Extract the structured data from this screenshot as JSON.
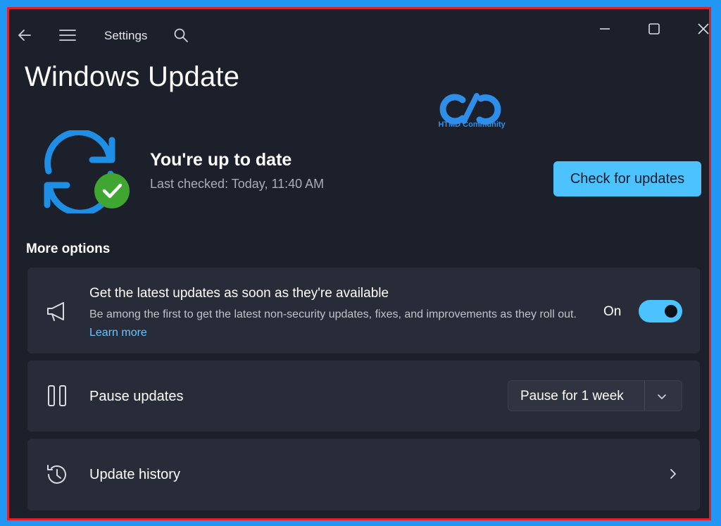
{
  "window": {
    "app_title": "Settings",
    "controls": [
      "minimize-icon",
      "maximize-icon",
      "close-icon"
    ]
  },
  "page": {
    "title": "Windows Update"
  },
  "logo": {
    "caption": "HTMD Community"
  },
  "status": {
    "title": "You're up to date",
    "last_checked": "Last checked: Today, 11:40 AM",
    "check_button": "Check for updates"
  },
  "more_options": {
    "heading": "More options",
    "latest_updates": {
      "title": "Get the latest updates as soon as they're available",
      "description": "Be among the first to get the latest non-security updates, fixes, and improvements as they roll out.",
      "learn_more": "Learn more",
      "toggle_label": "On",
      "toggle_on": true
    },
    "pause_updates": {
      "label": "Pause updates",
      "selected": "Pause for 1 week"
    },
    "update_history": {
      "label": "Update history"
    }
  },
  "colors": {
    "accent": "#4cc2ff",
    "background": "#1c202b",
    "card": "#272c38",
    "success": "#3fa632"
  }
}
